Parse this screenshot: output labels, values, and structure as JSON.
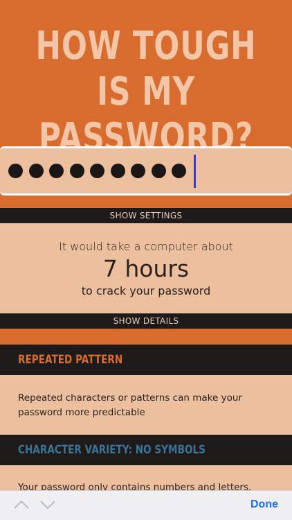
{
  "app": {
    "title_line1": "HOW TOUGH IS MY",
    "title_line2": "PASSWORD?"
  },
  "password": {
    "masked_length": 9,
    "caret": true
  },
  "settings_bar": {
    "label": "SHOW SETTINGS"
  },
  "result": {
    "line1": "It would take a computer about",
    "time": "7 hours",
    "line3": "to crack your password"
  },
  "details_bar": {
    "label": "SHOW DETAILS"
  },
  "sections": [
    {
      "title": "REPEATED PATTERN",
      "title_color": "#d86b2e",
      "body": "Repeated characters or patterns can make your password more predictable"
    },
    {
      "title": "CHARACTER VARIETY: NO SYMBOLS",
      "title_color": "#3b7296",
      "body": "Your password only contains numbers and letters. Adding a"
    }
  ],
  "keyboard_toolbar": {
    "prev_icon": "chevron-up-icon",
    "next_icon": "chevron-down-icon",
    "done_label": "Done"
  },
  "colors": {
    "background": "#d86b2e",
    "panel": "#ecbf9f",
    "dark": "#1e1a19",
    "caret": "#3a3ad6",
    "done": "#1a6ff0"
  }
}
